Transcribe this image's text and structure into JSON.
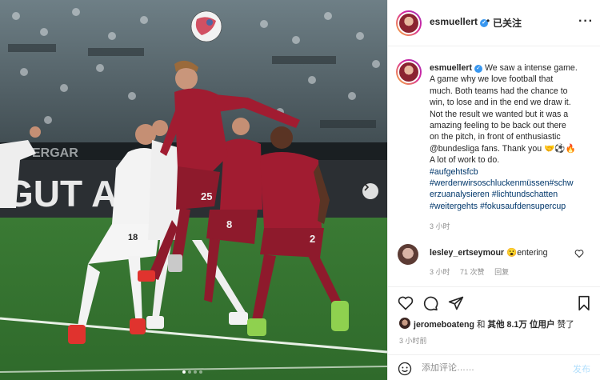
{
  "post": {
    "username": "esmuellert",
    "follow_status": "已关注",
    "caption_lines": [
      "We saw a intense game.",
      "A game why we love football that",
      "much. Both teams had the chance to",
      "win, to lose and in the end we draw it.",
      "Not the result we wanted but it was a",
      "amazing feeling to be back out there",
      "on the pitch, in front of enthusiastic",
      "@bundesliga fans. Thank you 🤝⚽🔥",
      "A lot of work to do."
    ],
    "hashtag_lines": [
      "#aufgehtsfcb",
      "#werdenwirsoschluckenmüssen#schw",
      "erzuanalysieren #lichtundschatten",
      "#weitergehts #fokusaufdensupercup"
    ],
    "caption_time": "3 小时",
    "comment": {
      "username": "lesley_ertseymour",
      "text": "😮entering",
      "time": "3 小时",
      "likes": "71 次赞",
      "reply": "回复"
    },
    "likes_line": {
      "user": "jeromeboateng",
      "middle": " 和 ",
      "others": "其他 8.1万 位用户",
      "suffix": " 赞了"
    },
    "post_time": "3 小时前",
    "comment_placeholder": "添加评论……",
    "post_button": "发布"
  },
  "media": {
    "stadium_banner_1": "GUT AU",
    "stadium_banner_2": "ERGAR",
    "player_numbers": [
      "25",
      "8",
      "2",
      "18"
    ],
    "carousel_count": 4,
    "carousel_active": 1
  },
  "colors": {
    "link": "#00376b",
    "muted": "#8e8e8e",
    "verified": "#3897f0",
    "bayern_red": "#9e1b2f",
    "pitch": "#3f7d35"
  },
  "icons": [
    "more-icon",
    "heart-icon",
    "comment-icon",
    "share-icon",
    "bookmark-icon",
    "emoji-icon",
    "chevron-right-icon",
    "verified-icon"
  ]
}
